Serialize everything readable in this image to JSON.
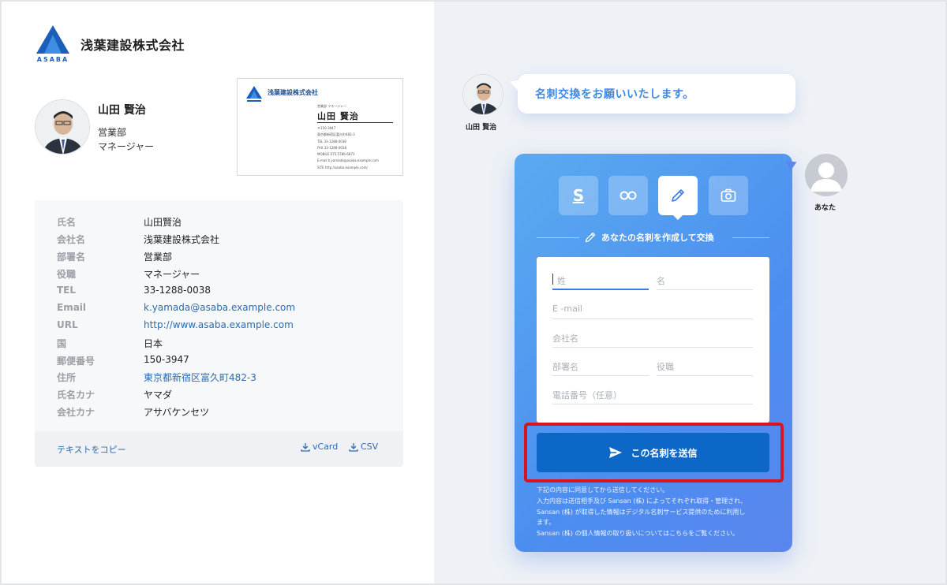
{
  "left": {
    "company_logo_text": "ASABA",
    "company_name": "浅葉建設株式会社",
    "person": {
      "name": "山田 賢治",
      "department": "営業部",
      "role": "マネージャー"
    },
    "business_card": {
      "company": "浅葉建設株式会社",
      "title_line": "営業部 マネージャー",
      "name": "山田 賢治",
      "lines": [
        "〒150-3947",
        "東京都新宿区富久町482-3",
        "TEL 33-1288-0038",
        "FAX 33-1288-0038",
        "MOBILE 075-5786-6873",
        "E-mail k.yamada@asaba.example.com",
        "SITE http://asaba.example.com/"
      ]
    },
    "info": [
      {
        "label": "氏名",
        "value": "山田賢治",
        "link": false
      },
      {
        "label": "会社名",
        "value": "浅葉建設株式会社",
        "link": false
      },
      {
        "label": "部署名",
        "value": "営業部",
        "link": false
      },
      {
        "label": "役職",
        "value": "マネージャー",
        "link": false
      },
      {
        "label": "TEL",
        "value": "33-1288-0038",
        "link": false
      },
      {
        "label": "Email",
        "value": "k.yamada@asaba.example.com",
        "link": true
      },
      {
        "label": "URL",
        "value": "http://www.asaba.example.com",
        "link": true
      },
      {
        "label": "国",
        "value": "日本",
        "link": false
      },
      {
        "label": "郵便番号",
        "value": "150-3947",
        "link": false
      },
      {
        "label": "住所",
        "value": "東京都新宿区富久町482-3",
        "link": true
      },
      {
        "label": "氏名カナ",
        "value": "ヤマダ",
        "link": false
      },
      {
        "label": "会社カナ",
        "value": "アサバケンセツ",
        "link": false
      }
    ],
    "footer": {
      "copy_text": "テキストをコピー",
      "vcard": "vCard",
      "csv": "CSV"
    }
  },
  "right": {
    "sender_name": "山田 賢治",
    "bubble_text": "名刺交換をお願いいたします。",
    "you_label": "あなた",
    "tabs": [
      {
        "icon": "sansan-icon",
        "label": "S"
      },
      {
        "icon": "link-icon",
        "label": ""
      },
      {
        "icon": "pencil-icon",
        "label": ""
      },
      {
        "icon": "camera-icon",
        "label": ""
      }
    ],
    "section_title": "あなたの名刺を作成して交換",
    "form": {
      "last_name": "姓",
      "first_name": "名",
      "email": "E -mail",
      "company": "会社名",
      "department": "部署名",
      "title": "役職",
      "phone": "電話番号（任意）"
    },
    "send_label": "この名刺を送信",
    "terms": [
      "下記の内容に同意してから送信してください。",
      "入力内容は送信相手及び Sansan (株) によってそれぞれ取得・管理され、",
      "Sansan (株) が取得した情報はデジタル名刺サービス提供のために利用し",
      "ます。",
      "Sansan (株) の個人情報の取り扱いについてはこちらをご覧ください。"
    ],
    "accent_color": "#0d67c6",
    "highlight_color": "#d8141e"
  }
}
